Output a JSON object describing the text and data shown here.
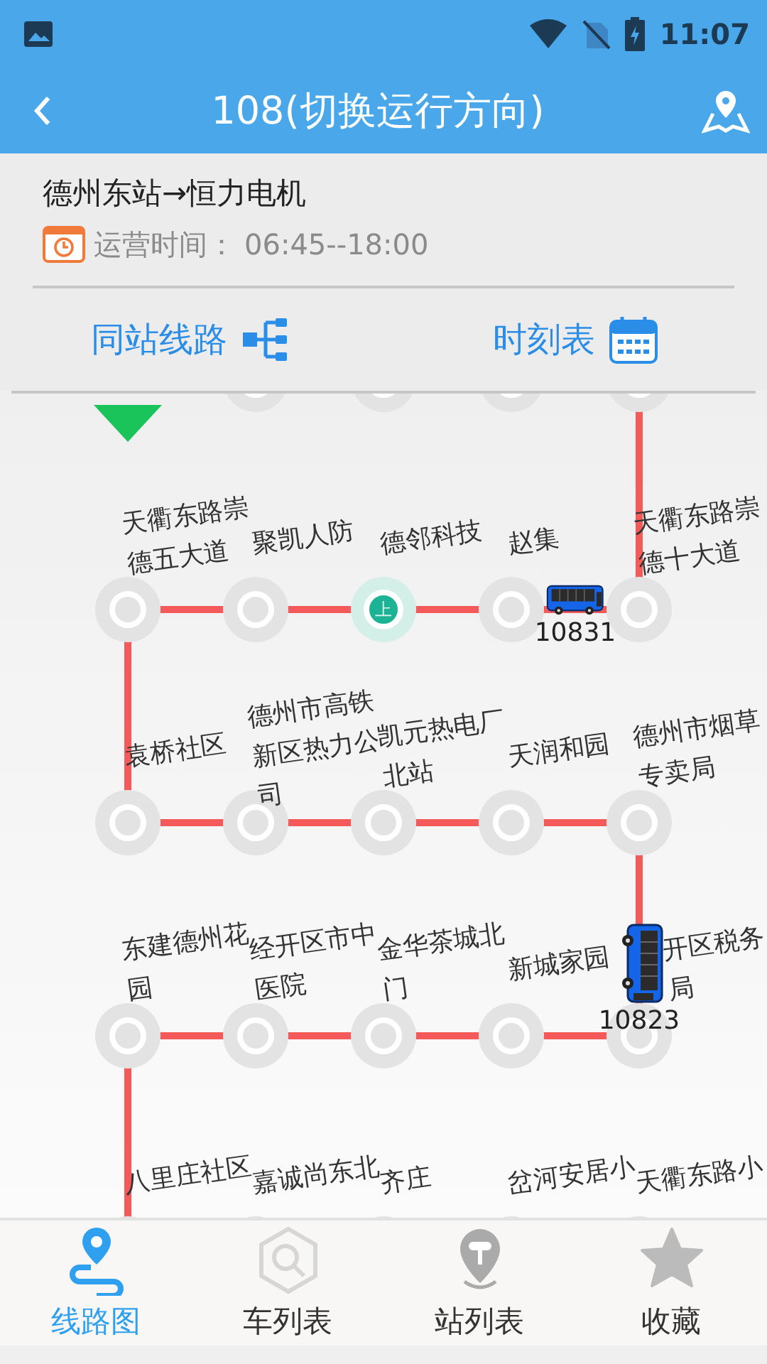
{
  "status_bar": {
    "time": "11:07"
  },
  "header": {
    "title": "108(切换运行方向)"
  },
  "route_info": {
    "name": "德州东站→恒力电机",
    "hours_label": "运营时间：",
    "hours": "06:45--18:00"
  },
  "actions": [
    {
      "label": "同站线路",
      "kind": "lines"
    },
    {
      "label": "时刻表",
      "kind": "timetable"
    }
  ],
  "route_map": {
    "rows": [
      [
        {
          "label": "天衢东路崇德五大道",
          "current": false
        },
        {
          "label": "聚凯人防",
          "current": false
        },
        {
          "label": "德邻科技",
          "current": true,
          "marker": "上"
        },
        {
          "label": "赵集",
          "current": false,
          "bus": {
            "number": "10831",
            "kind": "horizontal"
          }
        },
        {
          "label": "天衢东路崇德十大道",
          "current": false
        }
      ],
      [
        {
          "label": "袁桥社区",
          "current": false
        },
        {
          "label": "德州市高铁新区热力公司",
          "current": false
        },
        {
          "label": "凯元热电厂北站",
          "current": false
        },
        {
          "label": "天润和园",
          "current": false
        },
        {
          "label": "德州市烟草专卖局",
          "current": false
        }
      ],
      [
        {
          "label": "东建德州花园",
          "current": false
        },
        {
          "label": "经开区市中医院",
          "current": false
        },
        {
          "label": "金华茶城北门",
          "current": false
        },
        {
          "label": "新城家园",
          "current": false
        },
        {
          "label": "开区税务局",
          "current": false,
          "bus": {
            "number": "10823",
            "kind": "vertical"
          }
        }
      ],
      [
        {
          "label": "八里庄社区",
          "current": false
        },
        {
          "label": "嘉诚尚东北",
          "current": false
        },
        {
          "label": "齐庄",
          "current": false
        },
        {
          "label": "岔河安居小",
          "current": false
        },
        {
          "label": "天衢东路小",
          "current": false
        }
      ]
    ]
  },
  "tabs": [
    {
      "label": "线路图",
      "selected": true
    },
    {
      "label": "车列表",
      "selected": false
    },
    {
      "label": "站列表",
      "selected": false
    },
    {
      "label": "收藏",
      "selected": false
    }
  ]
}
